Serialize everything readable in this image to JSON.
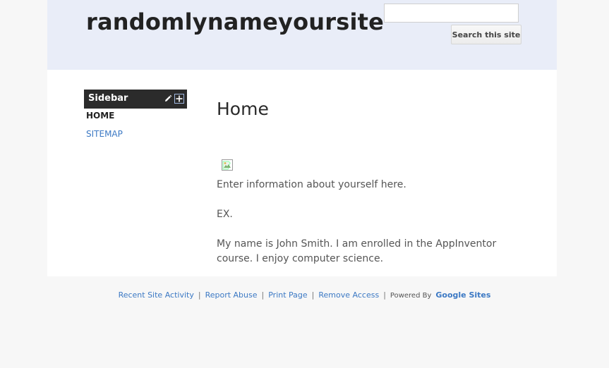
{
  "header": {
    "site_title": "randomlynameyoursite",
    "search": {
      "placeholder": "",
      "value": "",
      "button_label": "Search this site"
    }
  },
  "sidebar": {
    "title": "Sidebar",
    "items": [
      {
        "label": "HOME",
        "active": true
      },
      {
        "label": "SITEMAP",
        "active": false
      }
    ]
  },
  "main": {
    "heading": "Home",
    "paragraphs": [
      "Enter information about yourself here.",
      "EX.",
      "My name is John Smith. I am enrolled in the AppInventor course.  I enjoy computer science."
    ]
  },
  "footer": {
    "links": [
      "Recent Site Activity",
      "Report Abuse",
      "Print Page",
      "Remove Access"
    ],
    "powered_by": "Powered By",
    "brand": "Google Sites"
  },
  "colors": {
    "header_bg": "#e9edf8",
    "link": "#3c79c4",
    "sidebar_header_bg": "#2b2b2b",
    "page_bg": "#f7f7f7"
  },
  "icons": [
    "pencil-icon",
    "plus-icon",
    "broken-image-icon"
  ]
}
